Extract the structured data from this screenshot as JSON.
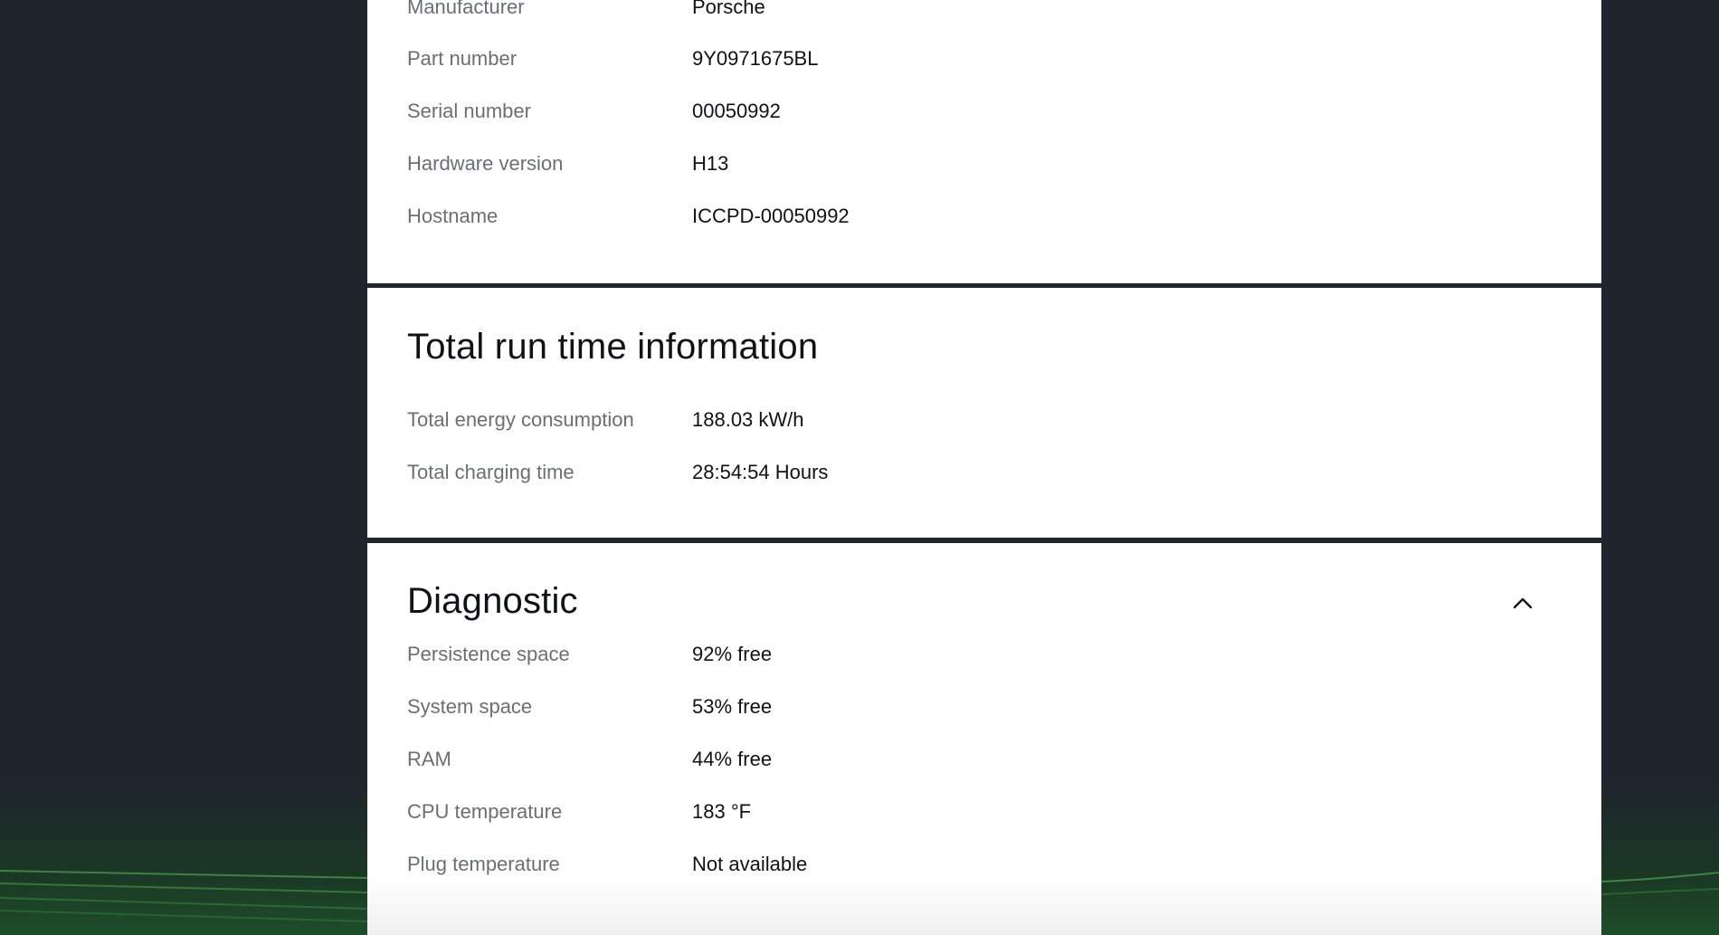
{
  "device_info": {
    "rows": [
      {
        "label": "Manufacturer",
        "value": "Porsche"
      },
      {
        "label": "Part number",
        "value": "9Y0971675BL"
      },
      {
        "label": "Serial number",
        "value": "00050992"
      },
      {
        "label": "Hardware version",
        "value": "H13"
      },
      {
        "label": "Hostname",
        "value": "ICCPD-00050992"
      }
    ]
  },
  "run_time": {
    "title": "Total run time information",
    "rows": [
      {
        "label": "Total energy consumption",
        "value": "188.03 kW/h"
      },
      {
        "label": "Total charging time",
        "value": "28:54:54 Hours"
      }
    ]
  },
  "diagnostic": {
    "title": "Diagnostic",
    "expanded": true,
    "toggle_icon": "chevron-up-icon",
    "rows": [
      {
        "label": "Persistence space",
        "value": "92% free"
      },
      {
        "label": "System space",
        "value": "53% free"
      },
      {
        "label": "RAM",
        "value": "44% free"
      },
      {
        "label": "CPU temperature",
        "value": "183 °F"
      },
      {
        "label": "Plug temperature",
        "value": "Not available"
      }
    ]
  },
  "colors": {
    "background": "#1f252c",
    "card": "#ffffff",
    "label_text": "#6b6f74",
    "value_text": "#101214",
    "accent_green": "#3fa84a"
  }
}
